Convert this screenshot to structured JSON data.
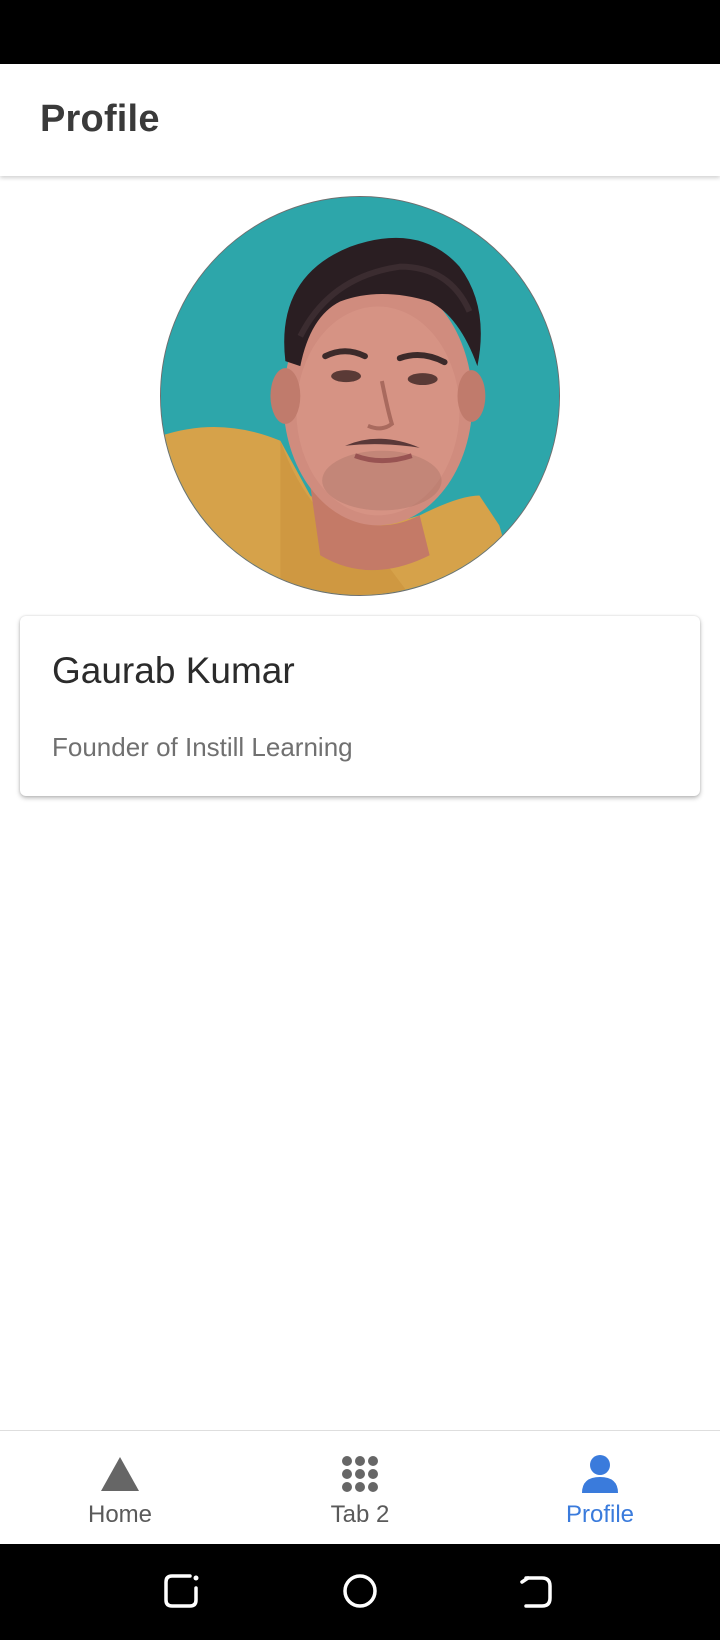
{
  "header": {
    "title": "Profile"
  },
  "profile": {
    "name": "Gaurab Kumar",
    "subtitle": "Founder of Instill Learning"
  },
  "tabs": [
    {
      "label": "Home",
      "icon": "triangle-icon",
      "active": false
    },
    {
      "label": "Tab 2",
      "icon": "grid-icon",
      "active": false
    },
    {
      "label": "Profile",
      "icon": "person-icon",
      "active": true
    }
  ],
  "colors": {
    "accent": "#3a7bdc",
    "inactive_tab": "#5a5a5a",
    "avatar_background": "#2aa3a8"
  },
  "system_nav": [
    "recent-apps-icon",
    "home-circle-icon",
    "back-icon"
  ]
}
